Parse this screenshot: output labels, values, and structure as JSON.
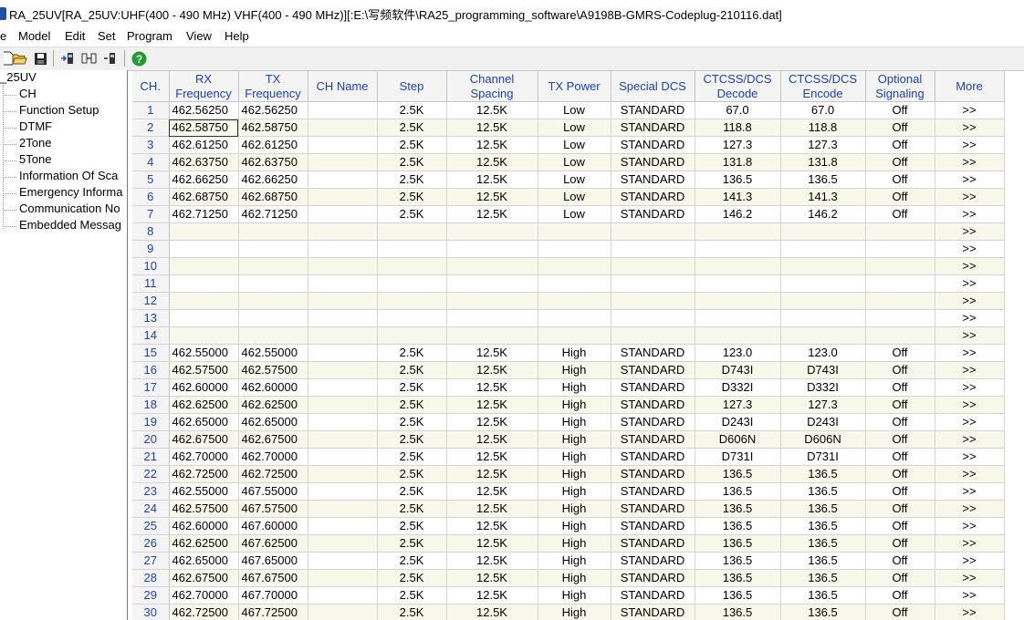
{
  "window": {
    "title": "RA_25UV[RA_25UV:UHF(400 - 490 MHz) VHF(400 - 490 MHz)][:E:\\写频软件\\RA25_programming_software\\A9198B-GMRS-Codeplug-210116.dat]"
  },
  "menu": {
    "items": [
      {
        "label": "e"
      },
      {
        "label": "Model"
      },
      {
        "label": "Edit"
      },
      {
        "label": "Set"
      },
      {
        "label": "Program"
      },
      {
        "label": "View"
      },
      {
        "label": "Help"
      }
    ]
  },
  "toolbar": {
    "icons": [
      "new-file-icon",
      "open-folder-icon",
      "save-icon",
      "read-from-radio-icon",
      "write-to-radio-icon",
      "device-icon",
      "help-icon"
    ]
  },
  "tree": {
    "root": "_25UV",
    "items": [
      {
        "label": "CH"
      },
      {
        "label": "Function Setup"
      },
      {
        "label": "DTMF"
      },
      {
        "label": "2Tone"
      },
      {
        "label": "5Tone"
      },
      {
        "label": "Information Of Sca"
      },
      {
        "label": "Emergency Informa"
      },
      {
        "label": "Communication No"
      },
      {
        "label": "Embedded Messag"
      }
    ]
  },
  "grid": {
    "headers": [
      {
        "line1": "CH.",
        "line2": ""
      },
      {
        "line1": "RX",
        "line2": "Frequency"
      },
      {
        "line1": "TX",
        "line2": "Frequency"
      },
      {
        "line1": "CH Name",
        "line2": ""
      },
      {
        "line1": "Step",
        "line2": ""
      },
      {
        "line1": "Channel",
        "line2": "Spacing"
      },
      {
        "line1": "TX Power",
        "line2": ""
      },
      {
        "line1": "Special DCS",
        "line2": ""
      },
      {
        "line1": "CTCSS/DCS",
        "line2": "Decode"
      },
      {
        "line1": "CTCSS/DCS",
        "line2": "Encode"
      },
      {
        "line1": "Optional",
        "line2": "Signaling"
      },
      {
        "line1": "More",
        "line2": ""
      }
    ],
    "rows": [
      {
        "ch": "1",
        "rx": "462.56250",
        "tx": "462.56250",
        "name": "",
        "step": "2.5K",
        "spacing": "12.5K",
        "power": "Low",
        "special": "STANDARD",
        "decode": "67.0",
        "encode": "67.0",
        "signaling": "Off",
        "more": ">>"
      },
      {
        "ch": "2",
        "rx": "462.58750",
        "tx": "462.58750",
        "name": "",
        "step": "2.5K",
        "spacing": "12.5K",
        "power": "Low",
        "special": "STANDARD",
        "decode": "118.8",
        "encode": "118.8",
        "signaling": "Off",
        "more": ">>"
      },
      {
        "ch": "3",
        "rx": "462.61250",
        "tx": "462.61250",
        "name": "",
        "step": "2.5K",
        "spacing": "12.5K",
        "power": "Low",
        "special": "STANDARD",
        "decode": "127.3",
        "encode": "127.3",
        "signaling": "Off",
        "more": ">>"
      },
      {
        "ch": "4",
        "rx": "462.63750",
        "tx": "462.63750",
        "name": "",
        "step": "2.5K",
        "spacing": "12.5K",
        "power": "Low",
        "special": "STANDARD",
        "decode": "131.8",
        "encode": "131.8",
        "signaling": "Off",
        "more": ">>"
      },
      {
        "ch": "5",
        "rx": "462.66250",
        "tx": "462.66250",
        "name": "",
        "step": "2.5K",
        "spacing": "12.5K",
        "power": "Low",
        "special": "STANDARD",
        "decode": "136.5",
        "encode": "136.5",
        "signaling": "Off",
        "more": ">>"
      },
      {
        "ch": "6",
        "rx": "462.68750",
        "tx": "462.68750",
        "name": "",
        "step": "2.5K",
        "spacing": "12.5K",
        "power": "Low",
        "special": "STANDARD",
        "decode": "141.3",
        "encode": "141.3",
        "signaling": "Off",
        "more": ">>"
      },
      {
        "ch": "7",
        "rx": "462.71250",
        "tx": "462.71250",
        "name": "",
        "step": "2.5K",
        "spacing": "12.5K",
        "power": "Low",
        "special": "STANDARD",
        "decode": "146.2",
        "encode": "146.2",
        "signaling": "Off",
        "more": ">>"
      },
      {
        "ch": "8",
        "rx": "",
        "tx": "",
        "name": "",
        "step": "",
        "spacing": "",
        "power": "",
        "special": "",
        "decode": "",
        "encode": "",
        "signaling": "",
        "more": ">>"
      },
      {
        "ch": "9",
        "rx": "",
        "tx": "",
        "name": "",
        "step": "",
        "spacing": "",
        "power": "",
        "special": "",
        "decode": "",
        "encode": "",
        "signaling": "",
        "more": ">>"
      },
      {
        "ch": "10",
        "rx": "",
        "tx": "",
        "name": "",
        "step": "",
        "spacing": "",
        "power": "",
        "special": "",
        "decode": "",
        "encode": "",
        "signaling": "",
        "more": ">>"
      },
      {
        "ch": "11",
        "rx": "",
        "tx": "",
        "name": "",
        "step": "",
        "spacing": "",
        "power": "",
        "special": "",
        "decode": "",
        "encode": "",
        "signaling": "",
        "more": ">>"
      },
      {
        "ch": "12",
        "rx": "",
        "tx": "",
        "name": "",
        "step": "",
        "spacing": "",
        "power": "",
        "special": "",
        "decode": "",
        "encode": "",
        "signaling": "",
        "more": ">>"
      },
      {
        "ch": "13",
        "rx": "",
        "tx": "",
        "name": "",
        "step": "",
        "spacing": "",
        "power": "",
        "special": "",
        "decode": "",
        "encode": "",
        "signaling": "",
        "more": ">>"
      },
      {
        "ch": "14",
        "rx": "",
        "tx": "",
        "name": "",
        "step": "",
        "spacing": "",
        "power": "",
        "special": "",
        "decode": "",
        "encode": "",
        "signaling": "",
        "more": ">>"
      },
      {
        "ch": "15",
        "rx": "462.55000",
        "tx": "462.55000",
        "name": "",
        "step": "2.5K",
        "spacing": "12.5K",
        "power": "High",
        "special": "STANDARD",
        "decode": "123.0",
        "encode": "123.0",
        "signaling": "Off",
        "more": ">>"
      },
      {
        "ch": "16",
        "rx": "462.57500",
        "tx": "462.57500",
        "name": "",
        "step": "2.5K",
        "spacing": "12.5K",
        "power": "High",
        "special": "STANDARD",
        "decode": "D743I",
        "encode": "D743I",
        "signaling": "Off",
        "more": ">>"
      },
      {
        "ch": "17",
        "rx": "462.60000",
        "tx": "462.60000",
        "name": "",
        "step": "2.5K",
        "spacing": "12.5K",
        "power": "High",
        "special": "STANDARD",
        "decode": "D332I",
        "encode": "D332I",
        "signaling": "Off",
        "more": ">>"
      },
      {
        "ch": "18",
        "rx": "462.62500",
        "tx": "462.62500",
        "name": "",
        "step": "2.5K",
        "spacing": "12.5K",
        "power": "High",
        "special": "STANDARD",
        "decode": "127.3",
        "encode": "127.3",
        "signaling": "Off",
        "more": ">>"
      },
      {
        "ch": "19",
        "rx": "462.65000",
        "tx": "462.65000",
        "name": "",
        "step": "2.5K",
        "spacing": "12.5K",
        "power": "High",
        "special": "STANDARD",
        "decode": "D243I",
        "encode": "D243I",
        "signaling": "Off",
        "more": ">>"
      },
      {
        "ch": "20",
        "rx": "462.67500",
        "tx": "462.67500",
        "name": "",
        "step": "2.5K",
        "spacing": "12.5K",
        "power": "High",
        "special": "STANDARD",
        "decode": "D606N",
        "encode": "D606N",
        "signaling": "Off",
        "more": ">>"
      },
      {
        "ch": "21",
        "rx": "462.70000",
        "tx": "462.70000",
        "name": "",
        "step": "2.5K",
        "spacing": "12.5K",
        "power": "High",
        "special": "STANDARD",
        "decode": "D731I",
        "encode": "D731I",
        "signaling": "Off",
        "more": ">>"
      },
      {
        "ch": "22",
        "rx": "462.72500",
        "tx": "462.72500",
        "name": "",
        "step": "2.5K",
        "spacing": "12.5K",
        "power": "High",
        "special": "STANDARD",
        "decode": "136.5",
        "encode": "136.5",
        "signaling": "Off",
        "more": ">>"
      },
      {
        "ch": "23",
        "rx": "462.55000",
        "tx": "467.55000",
        "name": "",
        "step": "2.5K",
        "spacing": "12.5K",
        "power": "High",
        "special": "STANDARD",
        "decode": "136.5",
        "encode": "136.5",
        "signaling": "Off",
        "more": ">>"
      },
      {
        "ch": "24",
        "rx": "462.57500",
        "tx": "467.57500",
        "name": "",
        "step": "2.5K",
        "spacing": "12.5K",
        "power": "High",
        "special": "STANDARD",
        "decode": "136.5",
        "encode": "136.5",
        "signaling": "Off",
        "more": ">>"
      },
      {
        "ch": "25",
        "rx": "462.60000",
        "tx": "467.60000",
        "name": "",
        "step": "2.5K",
        "spacing": "12.5K",
        "power": "High",
        "special": "STANDARD",
        "decode": "136.5",
        "encode": "136.5",
        "signaling": "Off",
        "more": ">>"
      },
      {
        "ch": "26",
        "rx": "462.62500",
        "tx": "467.62500",
        "name": "",
        "step": "2.5K",
        "spacing": "12.5K",
        "power": "High",
        "special": "STANDARD",
        "decode": "136.5",
        "encode": "136.5",
        "signaling": "Off",
        "more": ">>"
      },
      {
        "ch": "27",
        "rx": "462.65000",
        "tx": "467.65000",
        "name": "",
        "step": "2.5K",
        "spacing": "12.5K",
        "power": "High",
        "special": "STANDARD",
        "decode": "136.5",
        "encode": "136.5",
        "signaling": "Off",
        "more": ">>"
      },
      {
        "ch": "28",
        "rx": "462.67500",
        "tx": "467.67500",
        "name": "",
        "step": "2.5K",
        "spacing": "12.5K",
        "power": "High",
        "special": "STANDARD",
        "decode": "136.5",
        "encode": "136.5",
        "signaling": "Off",
        "more": ">>"
      },
      {
        "ch": "29",
        "rx": "462.70000",
        "tx": "467.70000",
        "name": "",
        "step": "2.5K",
        "spacing": "12.5K",
        "power": "High",
        "special": "STANDARD",
        "decode": "136.5",
        "encode": "136.5",
        "signaling": "Off",
        "more": ">>"
      },
      {
        "ch": "30",
        "rx": "462.72500",
        "tx": "467.72500",
        "name": "",
        "step": "2.5K",
        "spacing": "12.5K",
        "power": "High",
        "special": "STANDARD",
        "decode": "136.5",
        "encode": "136.5",
        "signaling": "Off",
        "more": ">>"
      }
    ]
  }
}
